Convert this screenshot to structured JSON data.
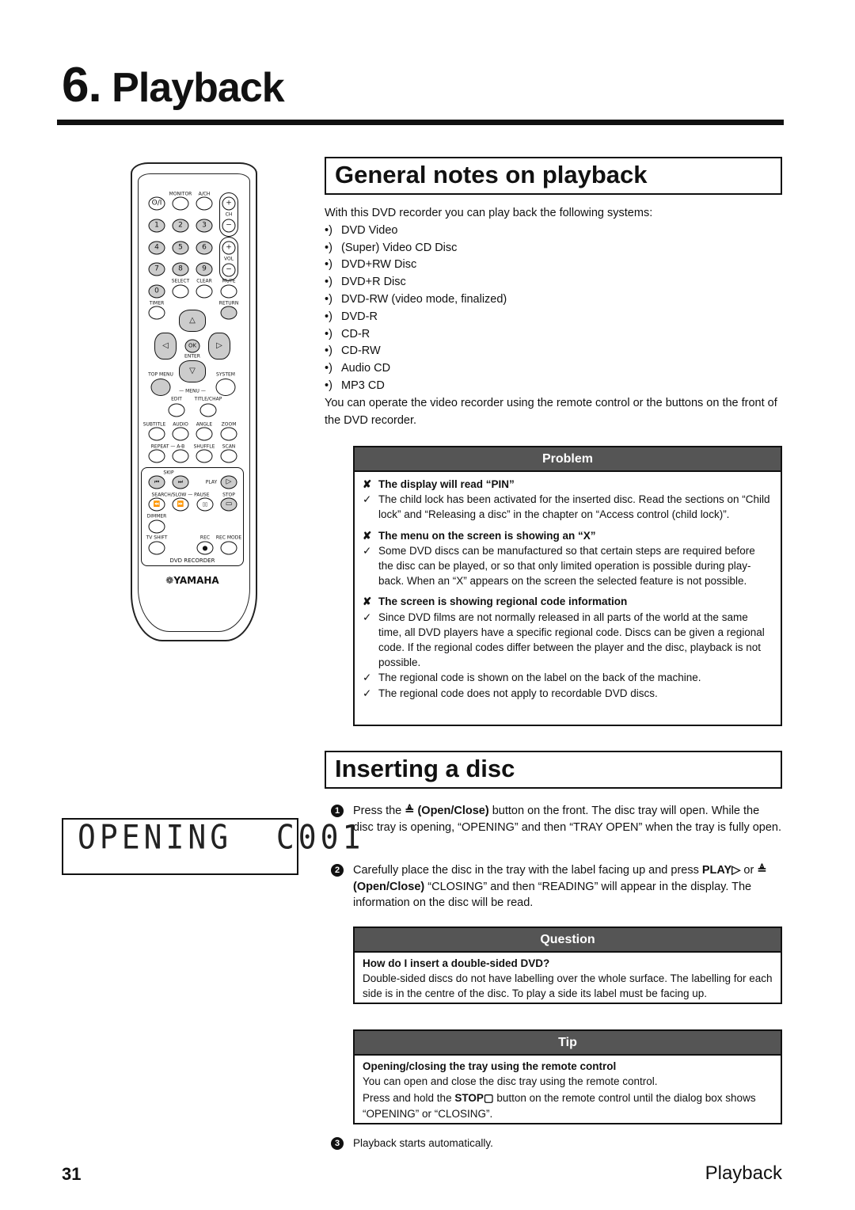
{
  "chapter": {
    "number": "6.",
    "title": "Playback"
  },
  "general": {
    "heading": "General notes on playback",
    "intro": "With this DVD recorder you can play back the following systems:",
    "bullet_marker": "•)",
    "systems": [
      "DVD Video",
      "(Super) Video CD Disc",
      "DVD+RW Disc",
      "DVD+R Disc",
      "DVD-RW (video mode, finalized)",
      "DVD-R",
      "CD-R",
      "CD-RW",
      "Audio CD",
      "MP3 CD"
    ],
    "outro": "You can operate the video recorder using the remote control or the buttons on the front of the DVD recorder."
  },
  "problem": {
    "header": "Problem",
    "cross": "✘",
    "check": "✓",
    "items": [
      {
        "q": "The display will read “PIN”",
        "a": [
          "The child lock has been activated for the inserted disc. Read the sections on “Child lock” and “Releasing a disc” in the chapter on “Access control (child lock)”."
        ]
      },
      {
        "q": "The menu on the screen is showing an “X”",
        "a": [
          "Some DVD discs can be manufactured so that certain steps are required before the disc can be played, or so that only limited operation is possible during play-back. When an “X” appears on the screen the selected feature is not possible."
        ]
      },
      {
        "q": "The screen is showing regional code information",
        "a": [
          "Since DVD films are not normally released in all parts of the world at the same time, all DVD players have a specific regional code. Discs can be given a regional code. If the regional codes differ between the player and the disc, playback is not possible.",
          "The regional code is shown on the label on the back of the machine.",
          "The regional code does not apply to recordable DVD discs."
        ]
      }
    ]
  },
  "inserting": {
    "heading": "Inserting a disc",
    "steps": [
      {
        "n": "1",
        "pre": "Press the ",
        "b1": "≜ (Open/Close)",
        "post": " button on the front. The disc tray will open. While the disc tray is opening, “OPENING” and then “TRAY OPEN” when the tray is fully open."
      },
      {
        "n": "2",
        "pre": "Carefully place the disc in the tray with the label facing up and press ",
        "b1": "PLAY▷",
        "mid": " or ",
        "b2": "≜ (Open/Close)",
        "post": " “CLOSING” and then “READING” will appear in the display. The information on the disc will be read."
      },
      {
        "n": "3",
        "pre": "Playback starts automatically."
      }
    ]
  },
  "question": {
    "header": "Question",
    "title": "How do I insert a double-sided DVD?",
    "text": "Double-sided discs do not have labelling over the whole surface. The labelling for each side is in the centre of the disc. To play a side its label must be facing up."
  },
  "tip": {
    "header": "Tip",
    "title": "Opening/closing the tray using the remote control",
    "line1": "You can open and close the disc tray using the remote control.",
    "line2_pre": "Press and hold the ",
    "line2_b": "STOP▢",
    "line2_post": " button on the remote control until the dialog box shows “OPENING” or “CLOSING”."
  },
  "display": {
    "text": "OPENING  C001"
  },
  "remote": {
    "labels": {
      "monitor": "MONITOR",
      "ach": "A/CH",
      "ch": "CH",
      "vol": "VOL",
      "select": "SELECT",
      "clear": "CLEAR",
      "mute": "MUTE",
      "timer": "TIMER",
      "return": "RETURN",
      "enter": "ENTER",
      "topmenu": "TOP MENU",
      "system": "SYSTEM",
      "menu": "— MENU —",
      "edit": "EDIT",
      "titlechap": "TITLE/CHAP",
      "subtitle": "SUBTITLE",
      "audio": "AUDIO",
      "angle": "ANGLE",
      "zoom": "ZOOM",
      "repeat": "REPEAT — A-B",
      "shuffle": "SHUFFLE",
      "scan": "SCAN",
      "skip": "SKIP",
      "play": "PLAY",
      "searchslow": "SEARCH/SLOW — PAUSE",
      "stop": "STOP",
      "dimmer": "DIMMER",
      "tvshift": "TV SHIFT",
      "rec": "REC",
      "recmode": "REC MODE",
      "dvdrecorder": "DVD RECORDER",
      "brand": "❁YAMAHA"
    },
    "keys": {
      "power": "ʘ/I",
      "k1": "1",
      "k2": "2",
      "k3": "3",
      "k4": "4",
      "k5": "5",
      "k6": "6",
      "k7": "7",
      "k8": "8",
      "k9": "9",
      "k0": "0",
      "plus": "+",
      "minus": "−",
      "up": "△",
      "down": "▽",
      "left": "◁",
      "right": "▷",
      "ok": "OK",
      "prev": "⏮",
      "next": "⏭",
      "playk": "▷",
      "rew": "⏪",
      "ff": "⏩",
      "pause": "▯▯",
      "stopk": "▭",
      "reck": "●"
    }
  },
  "footer": {
    "page": "31",
    "section": "Playback"
  }
}
